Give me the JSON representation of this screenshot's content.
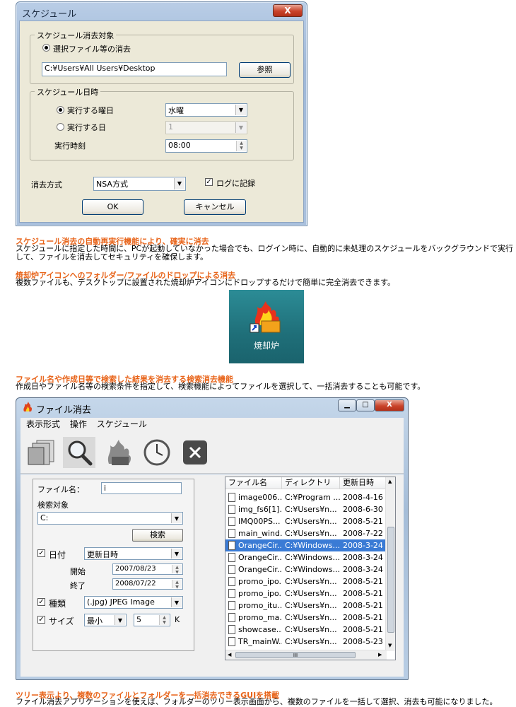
{
  "schedule_dialog": {
    "title": "スケジュール",
    "close_label": "X",
    "target_group": {
      "label": "スケジュール消去対象",
      "radio_label": "選択ファイル等の消去",
      "path_value": "C:¥Users¥All Users¥Desktop",
      "browse_label": "参照"
    },
    "datetime_group": {
      "label": "スケジュール日時",
      "weekday_radio_label": "実行する曜日",
      "weekday_value": "水曜",
      "day_radio_label": "実行する日",
      "day_value": "1",
      "time_label": "実行時刻",
      "time_value": "08:00"
    },
    "method_label": "消去方式",
    "method_value": "NSA方式",
    "log_label": "ログに記録",
    "ok_label": "OK",
    "cancel_label": "キャンセル"
  },
  "section1": {
    "heading": "スケジュール消去の自動再実行機能により、確実に消去",
    "line1": "スケジュールに指定した時間に、PCが起動していなかった場合でも、ログイン時に、自動的に未処理のスケジュールをバックグラウンドで実行",
    "line2": "して、ファイルを消去してセキュリティを確保します。"
  },
  "section2": {
    "heading": "焼却炉アイコンへのフォルダー/ファイルのドロップによる消去",
    "line1": "複数ファイルも、デスクトップに設置された焼却炉アイコンにドロップするだけで簡単に完全消去できます。",
    "icon_label": "焼却炉",
    "icon": "incinerator-shortcut-icon"
  },
  "section3": {
    "heading": "ファイル名や作成日等で検索した結果を消去する検索消去機能",
    "line1": "作成日やファイル名等の検索条件を指定して、検索機能によってファイルを選択して、一括消去することも可能です。"
  },
  "erase_window": {
    "title": "ファイル消去",
    "menu": [
      "表示形式",
      "操作",
      "スケジュール"
    ],
    "toolbar_icons": [
      "folders-icon",
      "search-icon",
      "flame-icon",
      "clock-icon",
      "close-icon"
    ],
    "search": {
      "filename_label": "ファイル名：",
      "filename_value": "i",
      "target_label": "検索対象",
      "target_value": "C:",
      "search_button": "検索",
      "date_label": "日付",
      "date_type": "更新日時",
      "start_label": "開始",
      "start_value": "2007/08/23",
      "end_label": "終了",
      "end_value": "2008/07/22",
      "kind_label": "種類",
      "kind_value": "(.jpg) JPEG Image",
      "size_label": "サイズ",
      "size_mode": "最小",
      "size_value": "5",
      "size_unit": "K"
    },
    "list": {
      "columns": [
        "ファイル名",
        "ディレクトリ",
        "更新日時"
      ],
      "rows": [
        [
          "image006...",
          "C:¥Program ...",
          "2008-4-16"
        ],
        [
          "img_fs6[1]...",
          "C:¥Users¥n...",
          "2008-6-30"
        ],
        [
          "IMQ00PS...",
          "C:¥Users¥n...",
          "2008-5-21"
        ],
        [
          "main_wind...",
          "C:¥Users¥n...",
          "2008-7-22"
        ],
        [
          "OrangeCir...",
          "C:¥Windows...",
          "2008-3-24"
        ],
        [
          "OrangeCir...",
          "C:¥Windows...",
          "2008-3-24"
        ],
        [
          "OrangeCir...",
          "C:¥Windows...",
          "2008-3-24"
        ],
        [
          "promo_ipo...",
          "C:¥Users¥n...",
          "2008-5-21"
        ],
        [
          "promo_ipo...",
          "C:¥Users¥n...",
          "2008-5-21"
        ],
        [
          "promo_itu...",
          "C:¥Users¥n...",
          "2008-5-21"
        ],
        [
          "promo_ma...",
          "C:¥Users¥n...",
          "2008-5-21"
        ],
        [
          "showcase...",
          "C:¥Users¥n...",
          "2008-5-21"
        ],
        [
          "TR_mainW...",
          "C:¥Users¥n...",
          "2008-5-23"
        ]
      ],
      "selected_row": 4,
      "hscroll_label": "III"
    }
  },
  "section4": {
    "heading": "ツリー表示より、複数のファイルとフォルダーを一括消去できるGUIを搭載",
    "line1": "ファイル消去アプリケーションを使えば、フォルダーのツリー表示画面から、複数のファイルを一括して選択、消去も可能になりました。"
  },
  "colors": {
    "heading": "#e8641a",
    "selection": "#3a7bd5"
  }
}
